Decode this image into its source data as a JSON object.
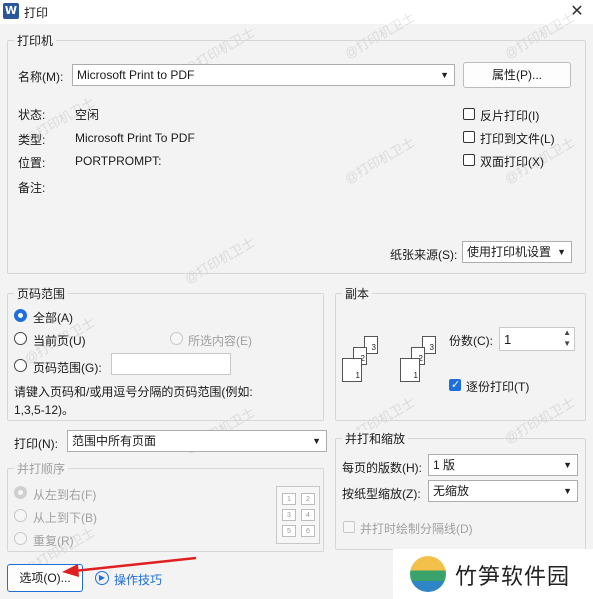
{
  "window": {
    "app_icon": "W",
    "title": "打印",
    "close": "✕"
  },
  "printer": {
    "legend": "打印机",
    "name_label": "名称(M):",
    "name_value": "Microsoft Print to PDF",
    "properties_button": "属性(P)...",
    "status_label": "状态:",
    "status_value": "空闲",
    "type_label": "类型:",
    "type_value": "Microsoft Print To PDF",
    "location_label": "位置:",
    "location_value": "PORTPROMPT:",
    "comment_label": "备注:",
    "reverse_print": {
      "label": "反片打印(I)",
      "checked": false
    },
    "print_to_file": {
      "label": "打印到文件(L)",
      "checked": false
    },
    "duplex": {
      "label": "双面打印(X)",
      "checked": false
    },
    "paper_source_label": "纸张来源(S):",
    "paper_source_value": "使用打印机设置"
  },
  "page_range": {
    "legend": "页码范围",
    "all": "全部(A)",
    "current": "当前页(U)",
    "selection": "所选内容(E)",
    "pages": "页码范围(G):",
    "pages_value": "",
    "hint_line1": "请键入页码和/或用逗号分隔的页码范围(例如:",
    "hint_line2": "1,3,5-12)。",
    "selected": "all"
  },
  "copies": {
    "legend": "副本",
    "count_label": "份数(C):",
    "count_value": "1",
    "collate_label": "逐份打印(T)",
    "collate_checked": true,
    "page_numbers": [
      "1",
      "2",
      "3"
    ]
  },
  "print_what": {
    "label": "打印(N):",
    "value": "范围中所有页面"
  },
  "order": {
    "legend": "并打顺序",
    "left_to_right": "从左到右(F)",
    "top_to_bottom": "从上到下(B)",
    "repeat": "重复(R)",
    "preview_numbers": [
      "1",
      "2",
      "3",
      "4",
      "5",
      "6"
    ]
  },
  "zoom": {
    "legend": "并打和缩放",
    "pages_per_sheet_label": "每页的版数(H):",
    "pages_per_sheet_value": "1 版",
    "scale_label": "按纸型缩放(Z):",
    "scale_value": "无缩放",
    "divider_label": "并打时绘制分隔线(D)"
  },
  "footer": {
    "options_button": "选项(O)...",
    "tips_link": "操作技巧"
  },
  "watermark_text": "@打印机卫士",
  "logo_text": "竹笋软件园",
  "colors": {
    "accent": "#1e6fd9",
    "arrow": "#e02020"
  }
}
